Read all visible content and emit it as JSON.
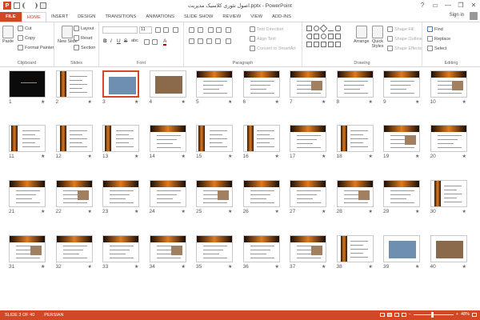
{
  "window": {
    "title": "اصول تئوری کلاسیک مدیریت.pptx - PowerPoint",
    "help": "?",
    "minimize": "—",
    "restore": "❐",
    "close": "✕"
  },
  "tabs": [
    {
      "label": "FILE"
    },
    {
      "label": "HOME"
    },
    {
      "label": "INSERT"
    },
    {
      "label": "DESIGN"
    },
    {
      "label": "TRANSITIONS"
    },
    {
      "label": "ANIMATIONS"
    },
    {
      "label": "SLIDE SHOW"
    },
    {
      "label": "REVIEW"
    },
    {
      "label": "VIEW"
    },
    {
      "label": "ADD-INS"
    }
  ],
  "account": {
    "signin": "Sign in"
  },
  "ribbon": {
    "clipboard": {
      "label": "Clipboard",
      "paste": "Paste",
      "cut": "Cut",
      "copy": "Copy",
      "format_painter": "Format Painter"
    },
    "slides": {
      "label": "Slides",
      "new_slide": "New Slide",
      "layout": "Layout",
      "reset": "Reset",
      "section": "Section"
    },
    "font": {
      "label": "Font",
      "font_size": "11",
      "bold": "B",
      "italic": "I",
      "underline": "U",
      "strike": "S",
      "shadow": "abc",
      "font_color": "A"
    },
    "paragraph": {
      "label": "Paragraph",
      "text_direction": "Text Direction",
      "align_text": "Align Text",
      "convert_smartart": "Convert to SmartArt"
    },
    "drawing": {
      "label": "Drawing",
      "arrange": "Arrange",
      "quick_styles": "Quick Styles",
      "shape_fill": "Shape Fill",
      "shape_outline": "Shape Outline",
      "shape_effects": "Shape Effects"
    },
    "editing": {
      "label": "Editing",
      "find": "Find",
      "replace": "Replace",
      "select": "Select"
    }
  },
  "slides": [
    {
      "num": "1"
    },
    {
      "num": "2"
    },
    {
      "num": "3"
    },
    {
      "num": "4"
    },
    {
      "num": "5"
    },
    {
      "num": "6"
    },
    {
      "num": "7"
    },
    {
      "num": "8"
    },
    {
      "num": "9"
    },
    {
      "num": "10"
    },
    {
      "num": "11"
    },
    {
      "num": "12"
    },
    {
      "num": "13"
    },
    {
      "num": "14"
    },
    {
      "num": "15"
    },
    {
      "num": "16"
    },
    {
      "num": "17"
    },
    {
      "num": "18"
    },
    {
      "num": "19"
    },
    {
      "num": "20"
    },
    {
      "num": "21"
    },
    {
      "num": "22"
    },
    {
      "num": "23"
    },
    {
      "num": "24"
    },
    {
      "num": "25"
    },
    {
      "num": "26"
    },
    {
      "num": "27"
    },
    {
      "num": "28"
    },
    {
      "num": "29"
    },
    {
      "num": "30"
    },
    {
      "num": "31"
    },
    {
      "num": "32"
    },
    {
      "num": "33"
    },
    {
      "num": "34"
    },
    {
      "num": "35"
    },
    {
      "num": "36"
    },
    {
      "num": "37"
    },
    {
      "num": "38"
    },
    {
      "num": "39"
    },
    {
      "num": "40"
    }
  ],
  "selected_slide": 3,
  "star": "★",
  "status": {
    "slide_info": "SLIDE 3 OF 40",
    "language": "PERSIAN",
    "zoom": "48%",
    "zoom_minus": "−",
    "zoom_plus": "+"
  },
  "colors": {
    "accent": "#d24726",
    "thumb_orange": "#e07a1f"
  }
}
